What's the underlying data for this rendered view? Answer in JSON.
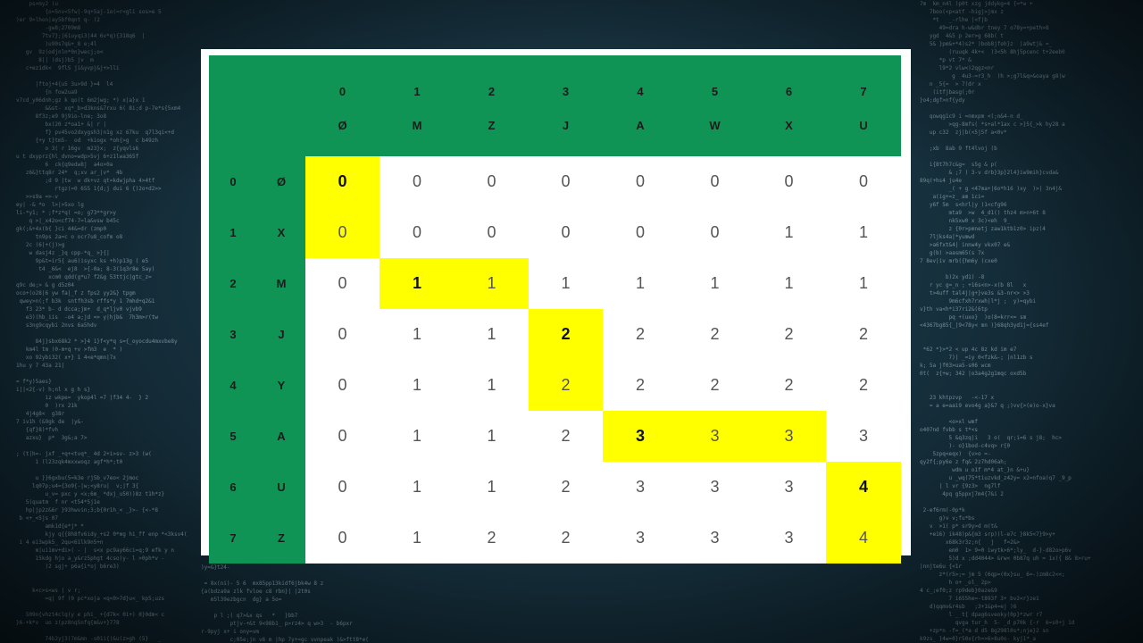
{
  "diagram": {
    "column_indices": [
      "0",
      "1",
      "2",
      "3",
      "4",
      "5",
      "6",
      "7"
    ],
    "column_chars": [
      "Ø",
      "M",
      "Z",
      "J",
      "A",
      "W",
      "X",
      "U"
    ],
    "rows": [
      {
        "index": "0",
        "char": "Ø",
        "values": [
          "0",
          "0",
          "0",
          "0",
          "0",
          "0",
          "0",
          "0"
        ],
        "highlight": [
          0
        ],
        "bold": [
          0
        ]
      },
      {
        "index": "1",
        "char": "X",
        "values": [
          "0",
          "0",
          "0",
          "0",
          "0",
          "0",
          "1",
          "1"
        ],
        "highlight": [
          0
        ],
        "bold": []
      },
      {
        "index": "2",
        "char": "M",
        "values": [
          "0",
          "1",
          "1",
          "1",
          "1",
          "1",
          "1",
          "1"
        ],
        "highlight": [
          1,
          2
        ],
        "bold": [
          1
        ]
      },
      {
        "index": "3",
        "char": "J",
        "values": [
          "0",
          "1",
          "1",
          "2",
          "2",
          "2",
          "2",
          "2"
        ],
        "highlight": [
          3
        ],
        "bold": [
          3
        ]
      },
      {
        "index": "4",
        "char": "Y",
        "values": [
          "0",
          "1",
          "1",
          "2",
          "2",
          "2",
          "2",
          "2"
        ],
        "highlight": [
          3
        ],
        "bold": []
      },
      {
        "index": "5",
        "char": "A",
        "values": [
          "0",
          "1",
          "1",
          "2",
          "3",
          "3",
          "3",
          "3"
        ],
        "highlight": [
          4,
          5,
          6
        ],
        "bold": [
          4
        ]
      },
      {
        "index": "6",
        "char": "U",
        "values": [
          "0",
          "1",
          "1",
          "2",
          "3",
          "3",
          "3",
          "4"
        ],
        "highlight": [
          7
        ],
        "bold": [
          7
        ]
      },
      {
        "index": "7",
        "char": "Z",
        "values": [
          "0",
          "1",
          "2",
          "2",
          "3",
          "3",
          "3",
          "4"
        ],
        "highlight": [
          7
        ],
        "bold": []
      }
    ]
  },
  "colors": {
    "header_green": "#0f9455",
    "highlight_yellow": "#ffff00",
    "background": "#16303d"
  }
}
